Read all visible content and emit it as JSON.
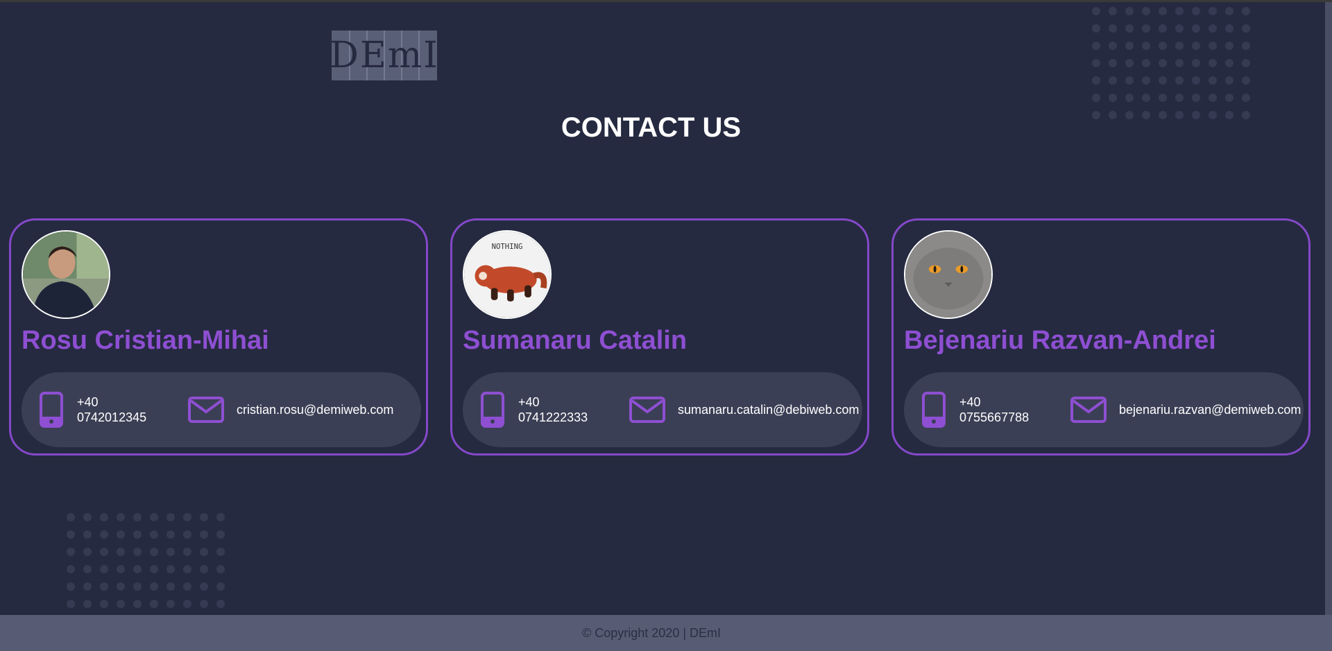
{
  "logo": {
    "text": "DEmI"
  },
  "page_title": "CONTACT US",
  "contacts": [
    {
      "name": "Rosu Cristian-Mihai",
      "phone_prefix": "+40",
      "phone_number": "0742012345",
      "email": "cristian.rosu@demiweb.com",
      "avatar": "man-photo"
    },
    {
      "name": "Sumanaru Catalin",
      "phone_prefix": "+40",
      "phone_number": "0741222333",
      "email": "sumanaru.catalin@debiweb.com",
      "avatar": "red-panda-illustration",
      "avatar_caption": "NOTHING"
    },
    {
      "name": "Bejenariu Razvan-Andrei",
      "phone_prefix": "+40",
      "phone_number": "0755667788",
      "email": "bejenariu.razvan@demiweb.com",
      "avatar": "grey-cat-photo"
    }
  ],
  "footer": {
    "text": "© Copyright 2020 | DEmI"
  },
  "colors": {
    "background": "#252a40",
    "accent": "#8e4fd2",
    "card_border": "#8448c9",
    "contact_bar": "#3b3f55",
    "footer": "#575b73"
  },
  "icons": {
    "phone": "phone-icon",
    "mail": "envelope-icon"
  }
}
